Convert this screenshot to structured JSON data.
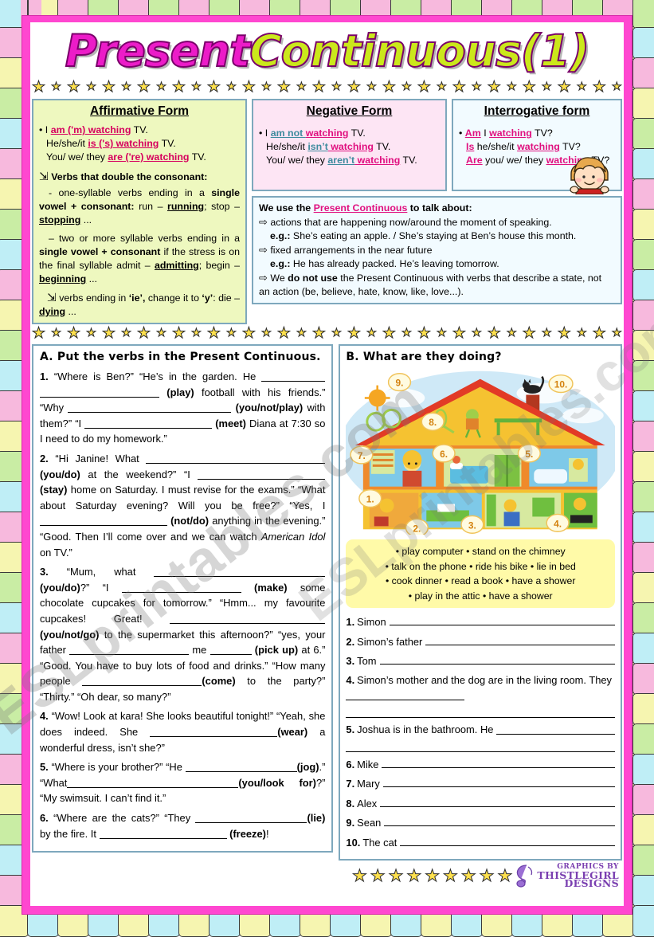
{
  "title": {
    "word1": "Present",
    "word2": "Continuous",
    "number": "(1)"
  },
  "watermark": {
    "text1": "ESLprintables.com",
    "text2": "ESLprintables.com"
  },
  "affirmative": {
    "heading": "Affirmative Form",
    "l1_a": "I ",
    "l1_b": "am ('m) watching",
    "l1_c": " TV.",
    "l2_a": "He/she/it  ",
    "l2_b": "is ('s) watching",
    "l2_c": " TV.",
    "l3_a": "You/ we/ they  ",
    "l3_b": "are ('re) watching",
    "l3_c": " TV.",
    "rule1_head": "Verbs that double the consonant:",
    "rule1_a": "- one-syllable verbs ending in a ",
    "rule1_b": "single vowel + consonant:",
    "rule1_c": " run – ",
    "rule1_d": "running",
    "rule1_e": "; stop – ",
    "rule1_f": "stopping",
    "rule1_g": " ...",
    "rule2_a": "– two or more syllable verbs ending in a ",
    "rule2_b": "single vowel + consonant",
    "rule2_c": " if the stress is on the final syllable admit – ",
    "rule2_d": "admitting",
    "rule2_e": "; begin – ",
    "rule2_f": "beginning",
    "rule2_g": " ...",
    "rule3_a": "verbs ending in ",
    "rule3_b": "‘ie’,",
    "rule3_c": " change it to ",
    "rule3_d": "‘y’",
    "rule3_e": ": die – ",
    "rule3_f": "dying",
    "rule3_g": " ..."
  },
  "negative": {
    "heading": "Negative Form",
    "l1_a": "I ",
    "l1_b": "am not ",
    "l1_c": "watching",
    "l1_d": " TV.",
    "l2_a": "He/she/it ",
    "l2_b": "isn’t",
    "l2_c": "  watching",
    "l2_d": " TV.",
    "l3_a": "You/ we/ they ",
    "l3_b": "aren’t",
    "l3_c": "  watching",
    "l3_d": " TV."
  },
  "interrogative": {
    "heading": "Interrogative form",
    "l1_a": "Am",
    "l1_b": " I ",
    "l1_c": "watching",
    "l1_d": " TV?",
    "l2_a": "Is",
    "l2_b": "  he/she/it ",
    "l2_c": "watching",
    "l2_d": " TV?",
    "l3_a": "Are",
    "l3_b": "  you/ we/ they  ",
    "l3_c": "watching",
    "l3_d": " TV?"
  },
  "usage": {
    "head_a": "We use the ",
    "head_b": "Present Continuous",
    "head_c": " to talk about:",
    "p1": "actions that are happening now/around the moment of speaking.",
    "eg1_label": "e.g.:",
    "eg1": " She’s eating an apple. / She’s staying at Ben’s house this month.",
    "p2": "fixed arrangements in the near future",
    "eg2_label": "e.g.:",
    "eg2": " He has already packed. He’s leaving tomorrow.",
    "p3_a": "We ",
    "p3_b": "do not use",
    "p3_c": " the Present Continuous with verbs that describe a state, not an action (be, believe, hate, know, like, love...)."
  },
  "exercise_a": {
    "title": "A. Put the verbs in the Present Continuous.",
    "items": [
      {
        "n": "1.",
        "parts": [
          {
            "t": "“Where is Ben?”  “He’s in the garden. He "
          },
          {
            "blank": 80
          },
          {
            "blank": 150
          },
          {
            "b": " (play)"
          },
          {
            "t": " football with his friends.” "
          },
          {
            "t": "“Why "
          },
          {
            "blank": 205
          },
          {
            "b": " (you/not/play)"
          },
          {
            "t": " with them?”  “I "
          },
          {
            "blank": 160
          },
          {
            "b": " (meet)"
          },
          {
            "t": " Diana at 7:30 so I need to do my homework.”"
          }
        ]
      },
      {
        "n": "2.",
        "parts": [
          {
            "t": "“Hi Janine! What "
          },
          {
            "blank": 225
          },
          {
            "b": "(you/do)"
          },
          {
            "t": " at the weekend?”  “I "
          },
          {
            "blank": 160
          },
          {
            "b": "(stay)"
          },
          {
            "t": " home on Saturday. I must revise for the exams.”  “What about Saturday evening? Will you be free?”  “Yes, I "
          },
          {
            "blank": 160
          },
          {
            "b": " (not/do)"
          },
          {
            "t": " anything in the evening.”  “Good. Then I’ll come over and we can watch "
          },
          {
            "i": "American Idol"
          },
          {
            "t": " on TV.”"
          }
        ]
      },
      {
        "n": "3.",
        "parts": [
          {
            "t": "“Mum, what "
          },
          {
            "blank": 215
          },
          {
            "b": " (you/do)"
          },
          {
            "t": "?”  “I "
          },
          {
            "blank": 150
          },
          {
            "b": " (make)"
          },
          {
            "t": " some chocolate cupcakes for tomorrow.”  “Hmm... my favourite cupcakes! Great! "
          },
          {
            "blank": 195
          },
          {
            "b": " (you/not/go)"
          },
          {
            "t": " to the supermarket this afternoon?”  “yes, your father "
          },
          {
            "blank": 150
          },
          {
            "t": " me "
          },
          {
            "blank": 52
          },
          {
            "b": " (pick up)"
          },
          {
            "t": " at 6.” “Good. You have to buy lots of food and drinks.”  “How many people "
          },
          {
            "blank": 150
          },
          {
            "b": "(come)"
          },
          {
            "t": " to the party?” “Thirty.”  “Oh dear, so many?”"
          }
        ]
      },
      {
        "n": "4.",
        "parts": [
          {
            "t": "“Wow! Look at kara! She looks beautiful tonight!” “Yeah, she does indeed. She "
          },
          {
            "blank": 160
          },
          {
            "b": "(wear)"
          },
          {
            "t": " a wonderful dress, isn’t she?”"
          }
        ]
      },
      {
        "n": "5.",
        "parts": [
          {
            "t": "“Where is your brother?”  “He "
          },
          {
            "blank": 140
          },
          {
            "b": "(jog)"
          },
          {
            "t": ".”   “What"
          },
          {
            "blank": 215
          },
          {
            "b": "(you/look for)"
          },
          {
            "t": "?” “My swimsuit. I can’t find it.”"
          }
        ]
      },
      {
        "n": "6.",
        "parts": [
          {
            "t": "“Where are the cats?”  “They "
          },
          {
            "blank": 140
          },
          {
            "b": "(lie)"
          },
          {
            "t": " by the fire. It "
          },
          {
            "blank": 160
          },
          {
            "b": " (freeze)"
          },
          {
            "t": "!"
          }
        ]
      }
    ]
  },
  "exercise_b": {
    "title": "B. What are they doing?",
    "house_callouts": [
      "1.",
      "2.",
      "3.",
      "4.",
      "5.",
      "6.",
      "7.",
      "8.",
      "9.",
      "10."
    ],
    "word_bank": [
      "play computer",
      "stand on the chimney",
      "talk on the phone",
      "ride his bike",
      "lie in bed",
      "cook dinner",
      "read a book",
      "have a shower",
      "play in the attic",
      "have a shower"
    ],
    "answers": [
      {
        "num": "1.",
        "name": "Simon",
        "wrap": false
      },
      {
        "num": "2.",
        "name": "Simon’s father",
        "wrap": false
      },
      {
        "num": "3.",
        "name": "Tom",
        "wrap": false
      },
      {
        "num": "4.",
        "name": "Simon’s mother and the dog are in the living room. They",
        "wrap": true
      },
      {
        "num": "5.",
        "name": "Joshua is in the bathroom. He",
        "wrap": true
      },
      {
        "num": "6.",
        "name": "Mike",
        "wrap": false
      },
      {
        "num": "7.",
        "name": "Mary",
        "wrap": false
      },
      {
        "num": "8.",
        "name": "Alex",
        "wrap": false
      },
      {
        "num": "9.",
        "name": "Sean",
        "wrap": false
      },
      {
        "num": "10.",
        "name": "The cat",
        "wrap": false
      }
    ]
  },
  "footer": {
    "logo_line1": "GRAPHICS BY",
    "logo_line2": "THISTLEGIRL",
    "logo_line3": "DESIGNS"
  },
  "colors": {
    "title_magenta": "#ec1cc8",
    "title_green": "#cbe81b",
    "frame_pink": "#ff47d0",
    "box_border": "#7ea8bd",
    "affirmative_bg": "#eef8bf",
    "negative_bg": "#fde5f4",
    "interrogative_bg": "#f2fbff",
    "wordbank_bg": "#fffaa8",
    "red_underline": "#d6005e",
    "teal_underline": "#3d8b9e",
    "logo_purple": "#7a3fb0"
  }
}
